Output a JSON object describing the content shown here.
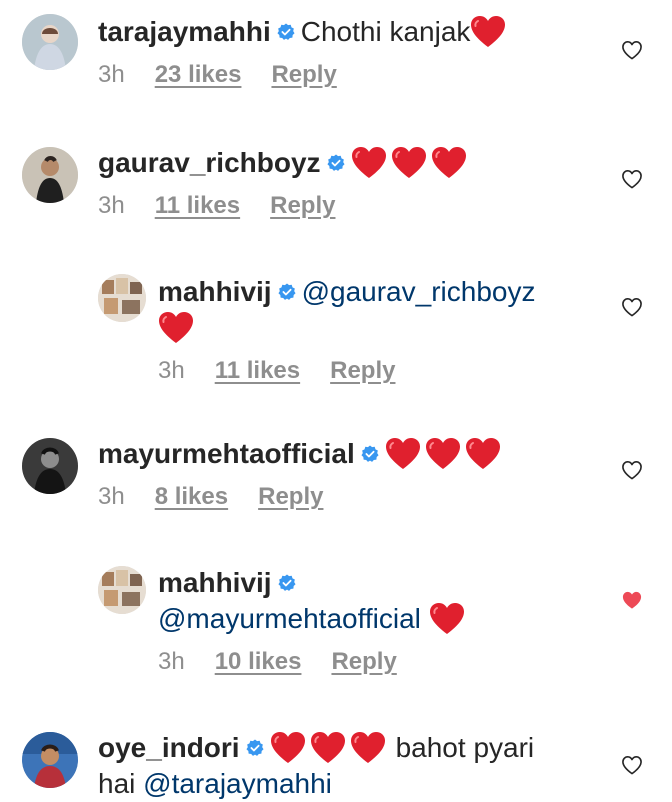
{
  "comments": [
    {
      "username": "tarajaymahhi",
      "text": "Chothi kanjak",
      "hearts": 1,
      "time": "3h",
      "likes": "23 likes",
      "reply": "Reply",
      "liked": false
    },
    {
      "username": "gaurav_richboyz",
      "text": "",
      "hearts": 3,
      "time": "3h",
      "likes": "11 likes",
      "reply": "Reply",
      "liked": false
    },
    {
      "username": "mahhivij",
      "mention": "@gaurav_richboyz",
      "hearts": 1,
      "time": "3h",
      "likes": "11 likes",
      "reply": "Reply",
      "liked": false
    },
    {
      "username": "mayurmehtaofficial",
      "text": "",
      "hearts": 3,
      "time": "3h",
      "likes": "8 likes",
      "reply": "Reply",
      "liked": false
    },
    {
      "username": "mahhivij",
      "mention": "@mayurmehtaofficial",
      "hearts": 1,
      "time": "3h",
      "likes": "10 likes",
      "reply": "Reply",
      "liked": true
    },
    {
      "username": "oye_indori",
      "hearts": 3,
      "text": "bahot pyari",
      "text2": "hai",
      "mention": "@tarajaymahhi",
      "liked": false
    }
  ],
  "colors": {
    "heart": "#e0202e",
    "liked": "#ed4956",
    "verified": "#3897f0",
    "mention": "#00376b",
    "meta": "#8e8e8e"
  },
  "icons": {
    "verified": "verified-badge-icon",
    "heart": "heart-emoji-icon",
    "like": "like-heart-icon"
  }
}
